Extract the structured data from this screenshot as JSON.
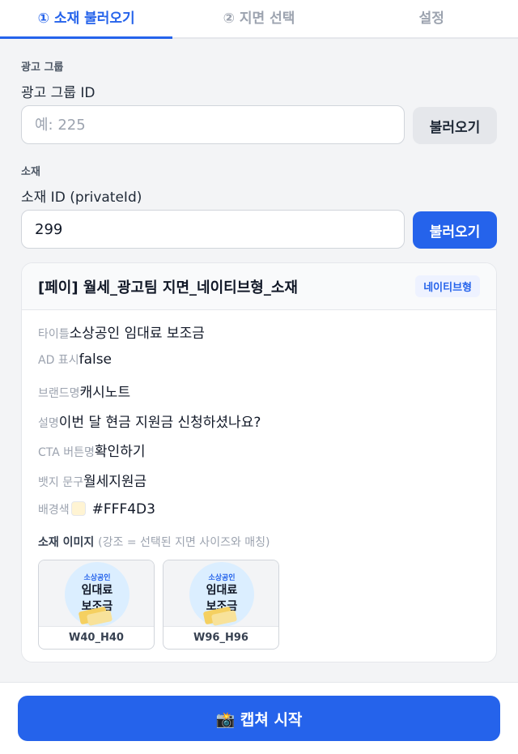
{
  "tabs": [
    {
      "label": "① 소재 불러오기",
      "active": true
    },
    {
      "label": "② 지면 선택",
      "active": false
    },
    {
      "label": "설정",
      "active": false
    }
  ],
  "ad_group": {
    "section_title": "광고 그룹",
    "label": "광고 그룹 ID",
    "placeholder": "예: 225",
    "value": "",
    "button_label": "불러오기"
  },
  "creative": {
    "section_title": "소재",
    "label": "소재 ID (privateId)",
    "value": "299",
    "button_label": "불러오기"
  },
  "card": {
    "title": "[페이] 월세_광고팀 지면_네이티브형_소재",
    "badge": "네이티브형",
    "fields": [
      {
        "key": "타이틀",
        "value": "소상공인 임대료 보조금"
      },
      {
        "key": "AD 표시",
        "value": "false"
      },
      {
        "key": "브랜드명",
        "value": "캐시노트"
      },
      {
        "key": "설명",
        "value": "이번 달 현금 지원금 신청하셨나요?"
      },
      {
        "key": "CTA 버튼명",
        "value": "확인하기"
      },
      {
        "key": "뱃지 문구",
        "value": "월세지원금"
      }
    ],
    "bg_color_key": "배경색",
    "bg_color_value": "#FFF4D3",
    "images_title": "소재 이미지",
    "images_note": "(강조 = 선택된 지면 사이즈와 매칭)",
    "images": [
      {
        "label": "W40_H40",
        "small_text": "소상공인",
        "big_line1": "임대료",
        "big_line2": "보조금"
      },
      {
        "label": "W96_H96",
        "small_text": "소상공인",
        "big_line1": "임대료",
        "big_line2": "보조금"
      }
    ]
  },
  "footer": {
    "capture_label": "📸 캡쳐 시작"
  },
  "colors": {
    "accent": "#2563eb",
    "swatch": "#FFF4D3"
  }
}
